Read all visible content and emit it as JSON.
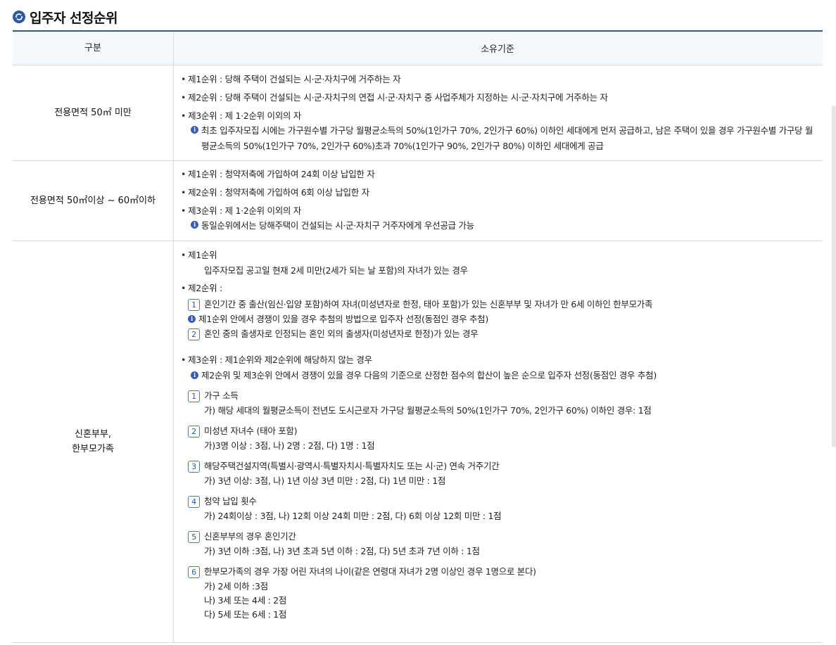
{
  "title": "입주자 선정순위",
  "header": {
    "col1": "구분",
    "col2": "소유기준"
  },
  "rows": [
    {
      "category": "전용면적 50㎡ 미만",
      "lines": [
        "제1순위 : 당해 주택이 건설되는 시·군·자치구에 거주하는 자",
        "제2순위 : 당해 주택이 건설되는 시·군·자치구의 연접 시·군·자치구 중 사업주체가 지정하는 시·군·자치구에 거주하는 자",
        "제3순위 : 제 1·2순위 이외의 자"
      ],
      "note": "최초 입주자모집 시에는 가구원수별 가구당 월평균소득의 50%(1인가구 70%, 2인가구 60%) 이하인 세대에게 먼저 공급하고, 남은 주택이 있을 경우 가구원수별 가구당 월평균소득의 50%(1인가구 70%, 2인가구 60%)초과 70%(1인가구 90%, 2인가구 80%) 이하인 세대에게 공급"
    },
    {
      "category": "전용면적 50㎡이상 ~ 60㎡이하",
      "lines": [
        "제1순위 : 청약저축에 가입하여 24회 이상 납입한 자",
        "제2순위 : 청약저축에 가입하여 6회 이상 납입한 자",
        "제3순위 : 제 1·2순위 이외의 자"
      ],
      "note": "동일순위에서는 당해주택이 건설되는 시·군·자치구 거주자에게 우선공급 가능"
    },
    {
      "category_line1": "신혼부부,",
      "category_line2": "한부모가족",
      "p1": "제1순위",
      "p1_detail": "입주자모집 공고일 현재 2세 미만(2세가 되는 날 포함)의 자녀가 있는 경우",
      "p2": "제2순위 :",
      "p2_items": [
        {
          "num": "1",
          "text": "혼인기간 중 출산(임신·입양 포함)하여 자녀(미성년자로 한정, 태아 포함)가 있는 신혼부부 및 자녀가 만 6세 이하인 한부모가족"
        },
        {
          "num": "2",
          "text": "혼인 중의 출생자로 인정되는 혼인 외의 출생자(미성년자로 한정)가 있는 경우"
        }
      ],
      "p2_note": "제1순위 안에서 경쟁이 있을 경우 추첨의 방법으로 입주자 선정(동점인 경우 추첨)",
      "p3": "제3순위 : 제1순위와 제2순위에 해당하지 않는 경우",
      "p3_note": "제2순위 및 제3순위 안에서 경쟁이 있을 경우 다음의 기준으로 산정한 점수의 합산이 높은 순으로 입주자 선정(동점인 경우 추첨)",
      "criteria": [
        {
          "num": "1",
          "title": "가구 소득",
          "details": [
            "가) 해당 세대의 월평균소득이 전년도 도시근로자 가구당 월평균소득의 50%(1인가구 70%, 2인가구 60%) 이하인 경우: 1점"
          ]
        },
        {
          "num": "2",
          "title": "미성년 자녀수 (태아 포함)",
          "details": [
            "가)3명 이상 : 3점, 나) 2명 : 2점, 다) 1명 : 1점"
          ]
        },
        {
          "num": "3",
          "title": "해당주택건설지역(특별시·광역시·특별자치시·특별자치도 또는 시·군) 연속 거주기간",
          "details": [
            "가) 3년 이상: 3점, 나) 1년 이상 3년 미만 : 2점, 다) 1년 미만 : 1점"
          ]
        },
        {
          "num": "4",
          "title": "청약 납입 횟수",
          "details": [
            "가) 24회이상 : 3점, 나) 12회 이상 24회 미만 : 2점, 다) 6회 이상 12회 미만 : 1점"
          ]
        },
        {
          "num": "5",
          "title": "신혼부부의 경우 혼인기간",
          "details": [
            "가) 3년 이하 :3점, 나) 3년 초과 5년 이하 : 2점, 다) 5년 초과 7년 이하 : 1점"
          ]
        },
        {
          "num": "6",
          "title": "한부모가족의 경우 가장 어린 자녀의 나이(같은 연령대 자녀가 2명 이상인 경우 1명으로 본다)",
          "details": [
            "가) 2세 이하 :3점",
            "나) 3세 또는 4세 : 2점",
            "다) 5세 또는 6세 : 1점"
          ]
        }
      ]
    }
  ]
}
